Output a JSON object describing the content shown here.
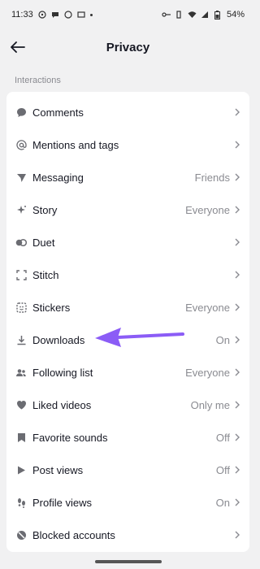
{
  "status_bar": {
    "time": "11:33",
    "battery": "54%"
  },
  "header": {
    "title": "Privacy"
  },
  "section": {
    "label": "Interactions"
  },
  "rows": [
    {
      "label": "Comments",
      "value": "",
      "icon": "comment-icon"
    },
    {
      "label": "Mentions and tags",
      "value": "",
      "icon": "at-icon"
    },
    {
      "label": "Messaging",
      "value": "Friends",
      "icon": "send-icon"
    },
    {
      "label": "Story",
      "value": "Everyone",
      "icon": "sparkle-icon"
    },
    {
      "label": "Duet",
      "value": "",
      "icon": "duet-icon"
    },
    {
      "label": "Stitch",
      "value": "",
      "icon": "stitch-icon"
    },
    {
      "label": "Stickers",
      "value": "Everyone",
      "icon": "sticker-icon"
    },
    {
      "label": "Downloads",
      "value": "On",
      "icon": "download-icon"
    },
    {
      "label": "Following list",
      "value": "Everyone",
      "icon": "people-icon"
    },
    {
      "label": "Liked videos",
      "value": "Only me",
      "icon": "heart-icon"
    },
    {
      "label": "Favorite sounds",
      "value": "Off",
      "icon": "bookmark-icon"
    },
    {
      "label": "Post views",
      "value": "Off",
      "icon": "play-icon"
    },
    {
      "label": "Profile views",
      "value": "On",
      "icon": "footprint-icon"
    },
    {
      "label": "Blocked accounts",
      "value": "",
      "icon": "block-icon"
    }
  ],
  "colors": {
    "annotation_arrow": "#8b5cf6",
    "text_secondary": "#8a8b91"
  }
}
